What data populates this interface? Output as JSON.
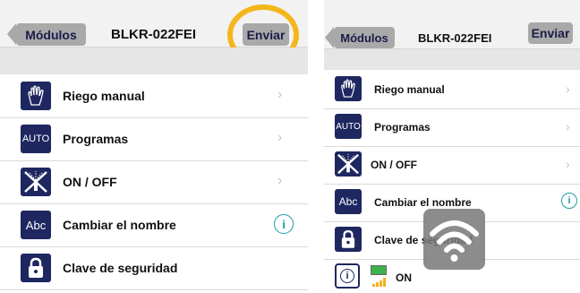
{
  "screens": [
    {
      "navbar": {
        "back_label": "Módulos",
        "title": "BLKR-022FEI",
        "send_label": "Enviar"
      },
      "rows": [
        {
          "label": "Riego manual",
          "icon": "hand-icon",
          "accessory": "chevron"
        },
        {
          "label": "Programas",
          "icon": "auto-icon",
          "icon_text": "AUTO",
          "accessory": "chevron"
        },
        {
          "label": "ON / OFF",
          "icon": "sprinkler-off-icon",
          "accessory": "chevron"
        },
        {
          "label": "Cambiar el nombre",
          "icon": "abc-icon",
          "icon_text": "Abc",
          "accessory": "info"
        },
        {
          "label": "Clave de seguridad",
          "icon": "lock-icon",
          "accessory": "none"
        }
      ],
      "highlight_color": "#f4b61c"
    },
    {
      "navbar": {
        "back_label": "Módulos",
        "title": "BLKR-022FEI",
        "send_label": "Enviar"
      },
      "rows": [
        {
          "label": "Riego manual",
          "icon": "hand-icon",
          "accessory": "chevron"
        },
        {
          "label": "Programas",
          "icon": "auto-icon",
          "icon_text": "AUTO",
          "accessory": "chevron"
        },
        {
          "label": "ON / OFF",
          "icon": "sprinkler-off-icon",
          "accessory": "chevron"
        },
        {
          "label": "Cambiar el nombre",
          "icon": "abc-icon",
          "icon_text": "Abc",
          "accessory": "info"
        },
        {
          "label": "Clave de seguridad",
          "icon": "lock-icon",
          "accessory": "none"
        },
        {
          "label": "ON",
          "icon": "info-icon",
          "accessory": "status"
        }
      ],
      "overlay_icon": "wifi-icon"
    }
  ],
  "colors": {
    "icon_bg": "#1e2760",
    "accent_info": "#1c9ea8",
    "button_gray": "#a9a9a9",
    "battery": "#3cb34a",
    "signal": "#f2b21c"
  },
  "info_glyph": "i"
}
